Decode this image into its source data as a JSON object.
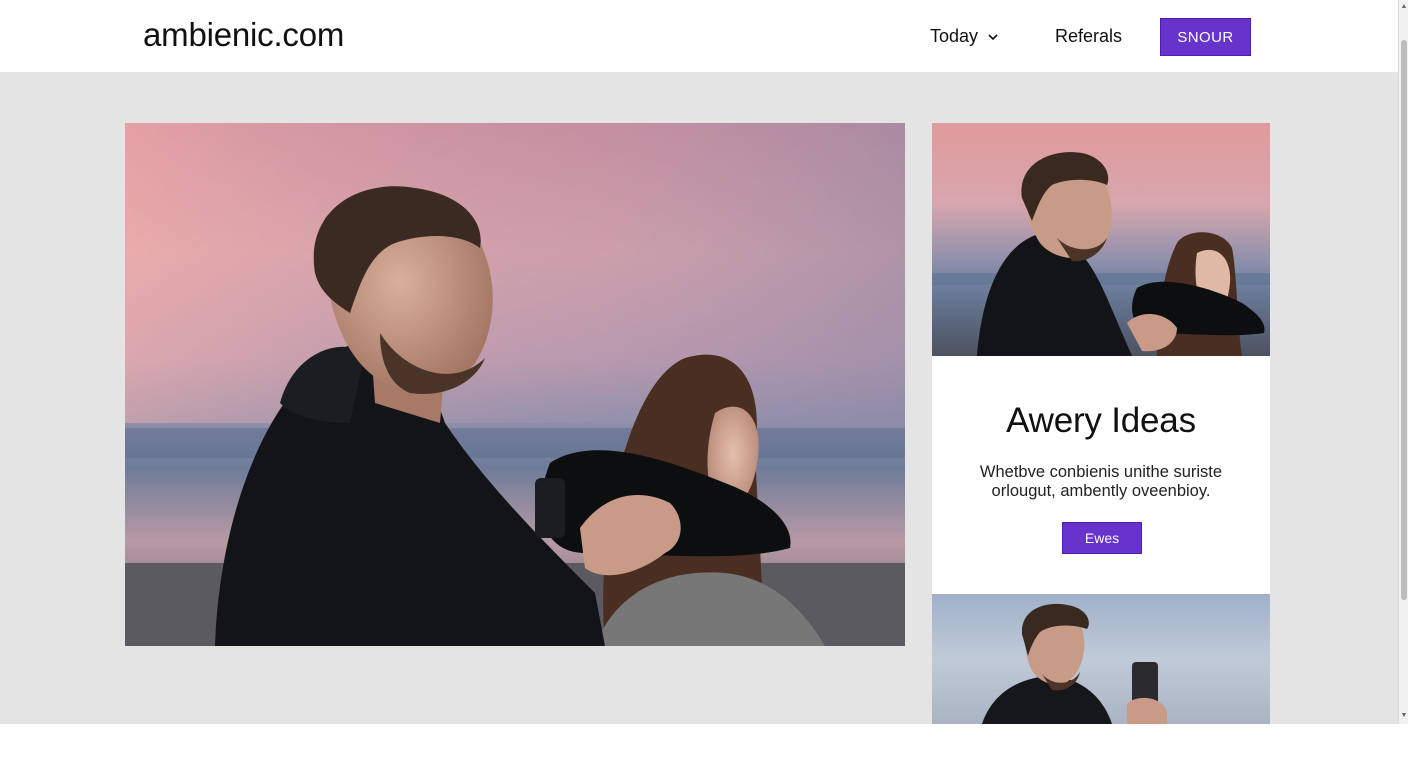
{
  "header": {
    "logo": "ambienic.com",
    "nav": [
      {
        "label": "Today",
        "has_dropdown": true
      },
      {
        "label": "Referals"
      }
    ],
    "cta_label": "Snour"
  },
  "hero": {
    "image": "photo of a man and a woman at a sunset shoreline, the woman holding a black headset to her face"
  },
  "side": {
    "top_image": "smaller photo of the same man and woman at the shoreline",
    "card": {
      "title": "Awery Ideas",
      "body": "Whetbve conbienis unithe suriste orlougut, ambently oveenbioy.",
      "button_label": "Ewes"
    },
    "bottom_image": "photo of a man in a black jacket holding a smartphone against a cloudy sky"
  },
  "colors": {
    "accent": "#6633cc",
    "background": "#e4e4e4",
    "header": "#ffffff"
  },
  "icons": {
    "dropdown": "chevron-down-icon"
  }
}
